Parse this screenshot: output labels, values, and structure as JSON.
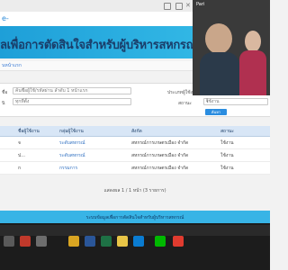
{
  "app": {
    "title": "e-"
  },
  "banner": {
    "title": "ลเพื่อการตัดสินใจสำหรับผู้บริหารสหกรณ์"
  },
  "breadcrumb": {
    "text": "นหน้าแรก"
  },
  "form": {
    "name_label": "ชื่อ",
    "name_placeholder": "ค้นชื่อผู้ใช้/รหัสผ่าน ลำดับ 1 หน้าแรก",
    "type_label": "ประเภทผู้ใช้งาน",
    "status_label": "สถานะ",
    "org_label": "นิ",
    "org_value": "ทุกที่ตั้ง",
    "status_value": "ใช้งาน",
    "search_label": "ค้นหา"
  },
  "table": {
    "headers": [
      "ชื่อผู้ใช้งาน",
      "กลุ่มผู้ใช้งาน",
      "สังกัด",
      "สถานะ"
    ],
    "rows": [
      {
        "user": "จ",
        "group": "ระดับสหกรณ์",
        "org": "สหกรณ์การเกษตรเมือง จำกัด",
        "status": "ใช้งาน"
      },
      {
        "user": "ป...",
        "group": "ระดับสหกรณ์",
        "org": "สหกรณ์การเกษตรเมือง จำกัด",
        "status": "ใช้งาน"
      },
      {
        "user": "ก",
        "group": "กรรมการ",
        "org": "สหกรณ์การเกษตรเมือง จำกัด",
        "status": "ใช้งาน"
      }
    ]
  },
  "pager": {
    "text": "แสดงผล 1 / 1 หน้า (3 รายการ)"
  },
  "footer": {
    "text": "ระบบข้อมูลเพื่อการตัดสินใจสำหรับผู้บริหารสหกรณ์"
  },
  "video_call": {
    "participant_name": "Pari"
  },
  "colors": {
    "banner_start": "#1e9fd8",
    "banner_end": "#39c0ea",
    "title": "#1a3e6a",
    "accent": "#2b8de0"
  },
  "taskbar": {
    "icons": [
      "start-icon",
      "search-icon",
      "task-view-icon",
      "file-explorer-icon",
      "word-icon",
      "excel-icon",
      "chrome-icon",
      "line-icon",
      "pdf-icon",
      "outlook-icon"
    ]
  }
}
